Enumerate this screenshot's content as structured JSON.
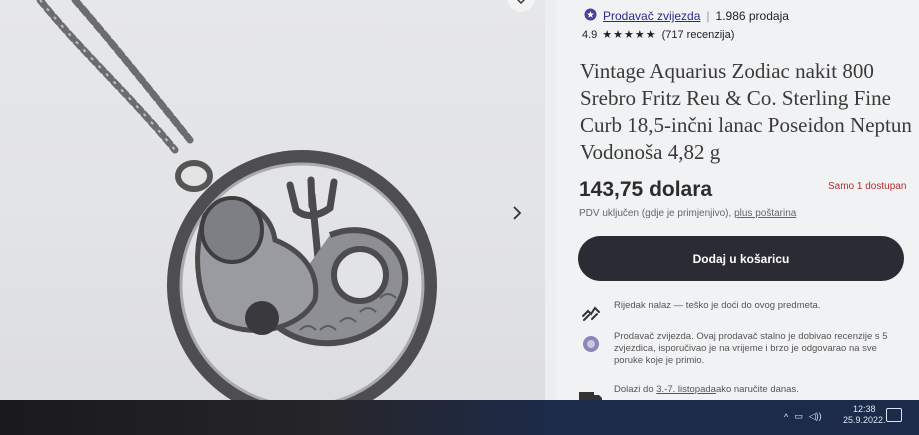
{
  "seller": {
    "name": "Prodavač zvijezda",
    "sales": "1.986 prodaja",
    "rating": "4.9",
    "stars": "★★★★★",
    "reviews": "(717 recenzija)"
  },
  "product": {
    "title": "Vintage Aquarius Zodiac nakit 800 Srebro Fritz Reu & Co. Sterling Fine Curb 18,5-inčni lanac Poseidon Neptun Vodonoša 4,82 g",
    "price": "143,75 dolara",
    "availability": "Samo 1 dostupan",
    "vat_prefix": "PDV uključen (gdje je primjenjivo),",
    "vat_link": "plus poštarina"
  },
  "actions": {
    "add_to_cart": "Dodaj u košaricu"
  },
  "features": {
    "rare": "Rijedak nalaz — teško je doći do ovog predmeta.",
    "star_seller": "Prodavač zvijezda. Ovaj prodavač stalno je dobivao recenzije s 5 zvjezdica, isporučivao je na vrijeme i brzo je odgovarao na sve poruke koje je primio.",
    "delivery_prefix": "Dolazi do",
    "delivery_date": "3.-7. listopada",
    "delivery_suffix": "ako naručite danas."
  },
  "taskbar": {
    "time": "12:38",
    "date": "25.9.2022."
  },
  "colors": {
    "accent_button": "#2b2b33",
    "availability": "#b03030",
    "seller_badge": "#4a3f9a"
  },
  "icons": [
    "heart-icon",
    "chevron-right-icon",
    "star-seller-badge-icon",
    "hands-icon",
    "star-badge-icon",
    "truck-icon",
    "notification-icon"
  ]
}
